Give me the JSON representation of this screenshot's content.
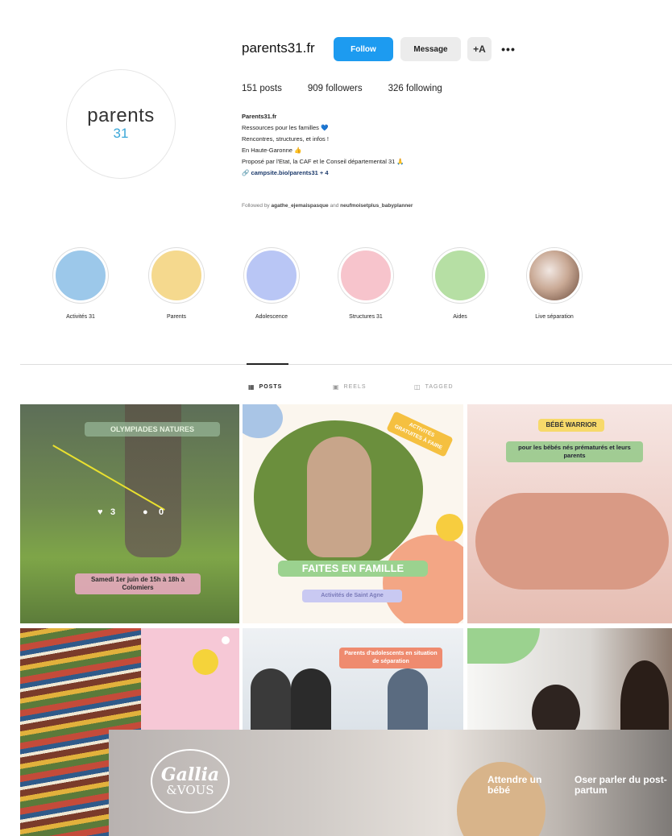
{
  "profile": {
    "avatar_line1": "parents",
    "avatar_line2": "31",
    "username": "parents31.fr",
    "follow_label": "Follow",
    "message_label": "Message",
    "adduser_icon": "+A",
    "more_icon": "•••",
    "stats": {
      "posts": "151 posts",
      "followers": "909 followers",
      "following": "326 following"
    },
    "bio": {
      "name": "Parents31.fr",
      "line1": "Ressources pour les familles 💙",
      "line2": "Rencontres, structures, et infos !",
      "line3": "En Haute-Garonne 👍",
      "line4": "Proposé par l'Etat, la CAF et le Conseil départemental 31 🙏",
      "link": "campsite.bio/parents31 + 4",
      "link_icon": "🔗"
    },
    "followed_by_prefix": "Followed by ",
    "followed_by_user1": "agathe_ejemaispasque",
    "followed_by_and": " and ",
    "followed_by_user2": "neufmoisetplus_babyplanner"
  },
  "highlights": [
    {
      "label": "Activités 31",
      "color": "#9cc8ea"
    },
    {
      "label": "Parents",
      "color": "#f5d98e"
    },
    {
      "label": "Adolescence",
      "color": "#b9c6f5"
    },
    {
      "label": "Structures 31",
      "color": "#f7c4cc"
    },
    {
      "label": "Aides",
      "color": "#b6dfa4"
    },
    {
      "label": "Live séparation",
      "color": "#d9cfc8"
    }
  ],
  "tabs": {
    "posts": "POSTS",
    "reels": "REELS",
    "tagged": "TAGGED",
    "posts_icon": "▦",
    "reels_icon": "▣",
    "tagged_icon": "◫"
  },
  "posts": {
    "p1": {
      "title": "OLYMPIADES NATURES",
      "likes": "3",
      "comments": "0",
      "caption": "Samedi 1er juin de 15h à 18h à Colomiers"
    },
    "p2": {
      "tag": "ACTIVITÉS GRATUITES À FAIRE",
      "headline": "FAITES EN FAMILLE",
      "subtag": "Activités de Saint Agne"
    },
    "p3": {
      "badge": "BÉBÉ WARRIOR",
      "sub": "pour les bébés nés prématurés et leurs parents"
    },
    "p5": {
      "tag": "Parents d'adolescents en situation de séparation"
    }
  },
  "ad": {
    "logo_line1": "Gallia",
    "logo_line2": "&VOUS",
    "link1": "Attendre un bébé",
    "link2": "Oser parler du post-partum"
  }
}
